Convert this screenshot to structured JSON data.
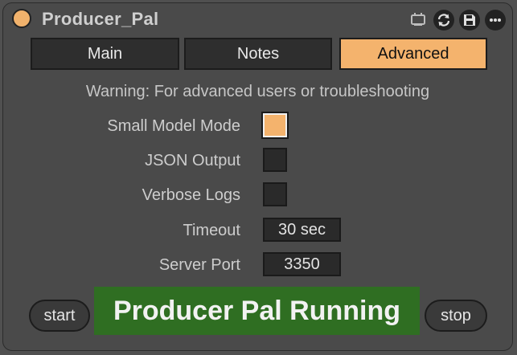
{
  "app": {
    "title": "Producer_Pal"
  },
  "title_icons": [
    "monitor-icon",
    "refresh-icon",
    "save-icon",
    "more-icon"
  ],
  "tabs": [
    {
      "label": "Main",
      "active": false
    },
    {
      "label": "Notes",
      "active": false
    },
    {
      "label": "Advanced",
      "active": true
    }
  ],
  "warning": "Warning: For advanced users or troubleshooting",
  "settings": {
    "small_model_mode": {
      "label": "Small Model Mode",
      "checked": true
    },
    "json_output": {
      "label": "JSON Output",
      "checked": false
    },
    "verbose_logs": {
      "label": "Verbose Logs",
      "checked": false
    },
    "timeout": {
      "label": "Timeout",
      "value": "30 sec"
    },
    "server_port": {
      "label": "Server Port",
      "value": "3350"
    }
  },
  "controls": {
    "start_label": "start",
    "stop_label": "stop",
    "status": "Producer Pal Running"
  },
  "colors": {
    "accent": "#f4b36d",
    "status_bg": "#2f6e22",
    "panel_bg": "#4a4a4a"
  }
}
